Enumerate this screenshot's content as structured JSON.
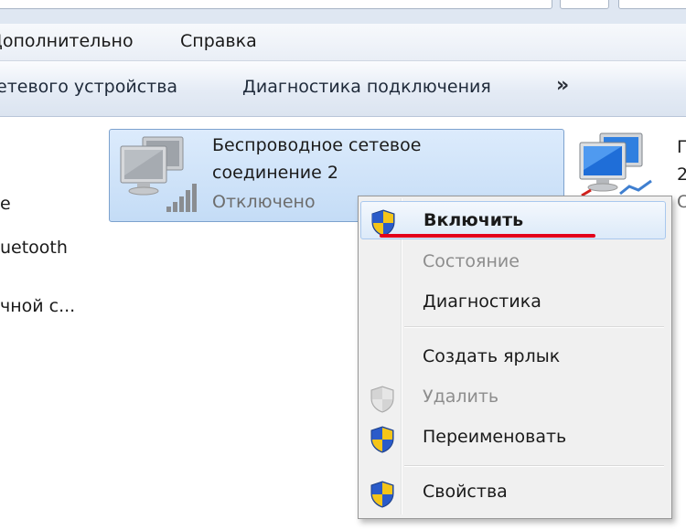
{
  "menu": {
    "items": [
      "Дополнительно",
      "Справка"
    ]
  },
  "toolbar": {
    "items": [
      "етевого устройства",
      "Диагностика подключения"
    ],
    "more": "»"
  },
  "left_nav": {
    "items": [
      "е",
      "uetooth",
      "чной с..."
    ]
  },
  "adapter": {
    "name_line1": "Беспроводное сетевое",
    "name_line2": "соединение 2",
    "status": "Отключено",
    "icon": "wireless-network-adapter-icon"
  },
  "adapter2": {
    "line1": "П",
    "line2": "2",
    "line3": "С",
    "icon": "network-adapter-icon"
  },
  "context_menu": {
    "items": [
      {
        "label": "Включить",
        "icon": "uac-shield-icon",
        "state": "default-highlighted"
      },
      {
        "label": "Состояние",
        "icon": "",
        "state": "disabled"
      },
      {
        "label": "Диагностика",
        "icon": "",
        "state": "enabled"
      },
      {
        "label": "Создать ярлык",
        "icon": "",
        "state": "enabled"
      },
      {
        "label": "Удалить",
        "icon": "uac-shield-icon",
        "state": "disabled"
      },
      {
        "label": "Переименовать",
        "icon": "uac-shield-icon",
        "state": "enabled"
      },
      {
        "label": "Свойства",
        "icon": "uac-shield-icon",
        "state": "enabled"
      }
    ]
  },
  "colors": {
    "selection": "#cde2f8",
    "annotation_red": "#e3001b",
    "shield_blue": "#2a5bc9",
    "shield_yellow": "#f5c518"
  }
}
